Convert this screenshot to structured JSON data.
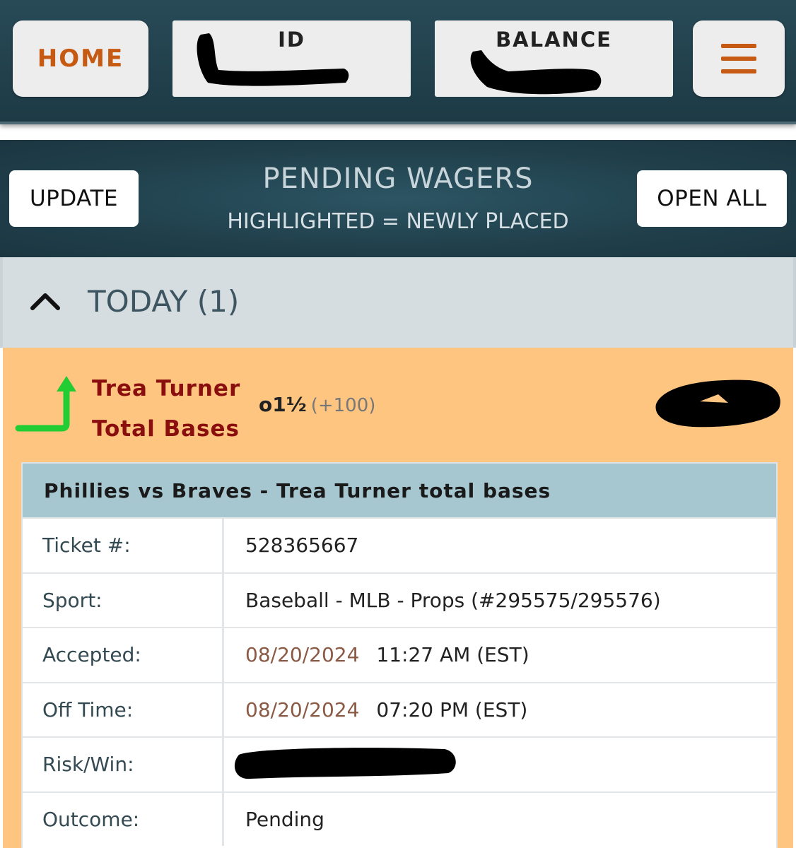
{
  "topbar": {
    "home_label": "HOME",
    "id_label": "ID",
    "balance_label": "BALANCE",
    "accent_color": "#c65a13",
    "menu_icon": "hamburger-menu-icon"
  },
  "header": {
    "update_label": "UPDATE",
    "title": "PENDING WAGERS",
    "subtitle": "HIGHLIGHTED = NEWLY PLACED",
    "open_all_label": "OPEN ALL"
  },
  "today": {
    "label": "TODAY (1)",
    "toggle_icon": "chevron-up-icon"
  },
  "wager": {
    "highlight_color": "#fec580",
    "arrow_icon": "arrow-up-icon",
    "bet_name_line1": "Trea Turner",
    "bet_name_line2": "Total Bases",
    "over_under": "o1½",
    "odds": "(+100)",
    "detail_title": "Phillies vs Braves - Trea Turner total bases",
    "rows": {
      "ticket": {
        "label": "Ticket #:",
        "value": "528365667"
      },
      "sport": {
        "label": "Sport:",
        "value": "Baseball - MLB - Props (#295575/295576)"
      },
      "accepted": {
        "label": "Accepted:",
        "date": "08/20/2024",
        "time": "11:27 AM (EST)"
      },
      "off_time": {
        "label": "Off Time:",
        "date": "08/20/2024",
        "time": "07:20 PM (EST)"
      },
      "risk_win": {
        "label": "Risk/Win:"
      },
      "outcome": {
        "label": "Outcome:",
        "value": "Pending"
      }
    }
  }
}
